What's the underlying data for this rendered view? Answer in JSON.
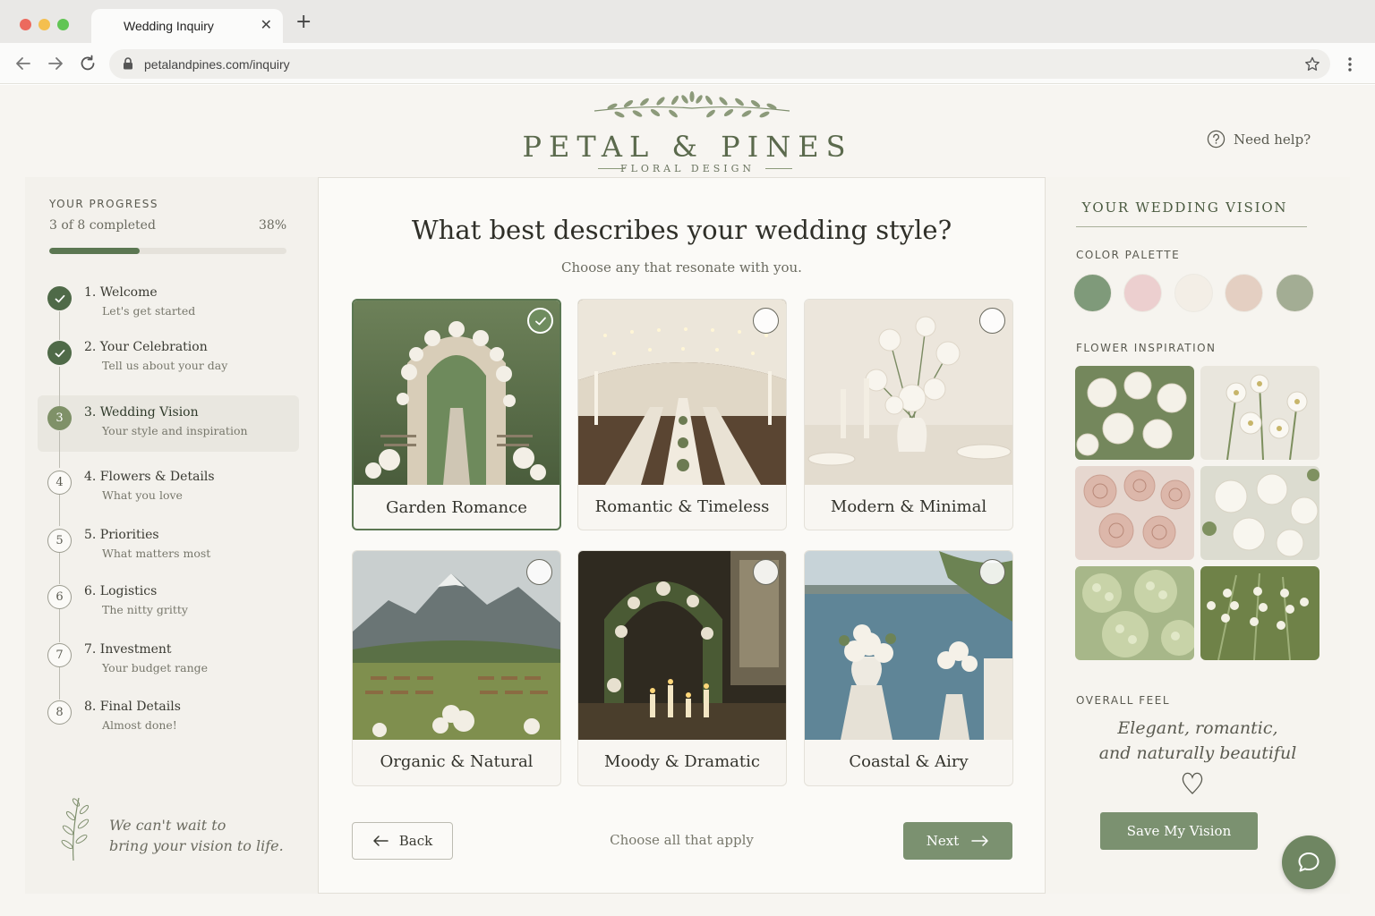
{
  "browser": {
    "tab_title": "Wedding Inquiry",
    "tab_close": "✕",
    "new_tab": "+",
    "url": "petalandpines.com/inquiry"
  },
  "brand": {
    "name": "PETAL & PINES",
    "tagline": "FLORAL DESIGN"
  },
  "help": {
    "label": "Need help?"
  },
  "progress": {
    "caption": "YOUR PROGRESS",
    "count_text": "3 of 8 completed",
    "percent_text": "38%",
    "fraction": 0.38
  },
  "steps": [
    {
      "badge": "",
      "title": "1.   Welcome",
      "subtitle": "Let's get started",
      "status": "done"
    },
    {
      "badge": "",
      "title": "2.   Your Celebration",
      "subtitle": "Tell us about your day",
      "status": "done"
    },
    {
      "badge": "3",
      "title": "3.   Wedding Vision",
      "subtitle": "Your style and inspiration",
      "status": "current"
    },
    {
      "badge": "4",
      "title": "4.   Flowers & Details",
      "subtitle": "What you love",
      "status": "todo"
    },
    {
      "badge": "5",
      "title": "5.   Priorities",
      "subtitle": "What matters most",
      "status": "todo"
    },
    {
      "badge": "6",
      "title": "6.   Logistics",
      "subtitle": "The nitty gritty",
      "status": "todo"
    },
    {
      "badge": "7",
      "title": "7.   Investment",
      "subtitle": "Your budget range",
      "status": "todo"
    },
    {
      "badge": "8",
      "title": "8.   Final Details",
      "subtitle": "Almost done!",
      "status": "todo"
    }
  ],
  "quote": {
    "line1": "We can't wait to",
    "line2": "bring your vision to life."
  },
  "question": {
    "title": "What best describes your wedding style?",
    "subtitle": "Choose any that resonate with you."
  },
  "styles": [
    {
      "label": "Garden Romance",
      "selected": true
    },
    {
      "label": "Romantic & Timeless",
      "selected": false
    },
    {
      "label": "Modern & Minimal",
      "selected": false
    },
    {
      "label": "Organic & Natural",
      "selected": false
    },
    {
      "label": "Moody & Dramatic",
      "selected": false
    },
    {
      "label": "Coastal & Airy",
      "selected": false
    }
  ],
  "footer": {
    "back_label": "Back",
    "hint": "Choose all that apply",
    "next_label": "Next"
  },
  "vision": {
    "title": "YOUR WEDDING VISION",
    "palette_caption": "COLOR PALETTE",
    "palette": [
      "#7f9a7a",
      "#eccfcf",
      "#f3eee6",
      "#e4cfc2",
      "#a3ad94"
    ],
    "flower_caption": "FLOWER INSPIRATION",
    "feel_caption": "OVERALL FEEL",
    "feel_line1": "Elegant, romantic,",
    "feel_line2": "and naturally beautiful",
    "save_label": "Save My Vision"
  },
  "colors": {
    "accent": "#5b7752",
    "button": "#7b9170",
    "page_bg": "#f7f5f1"
  }
}
